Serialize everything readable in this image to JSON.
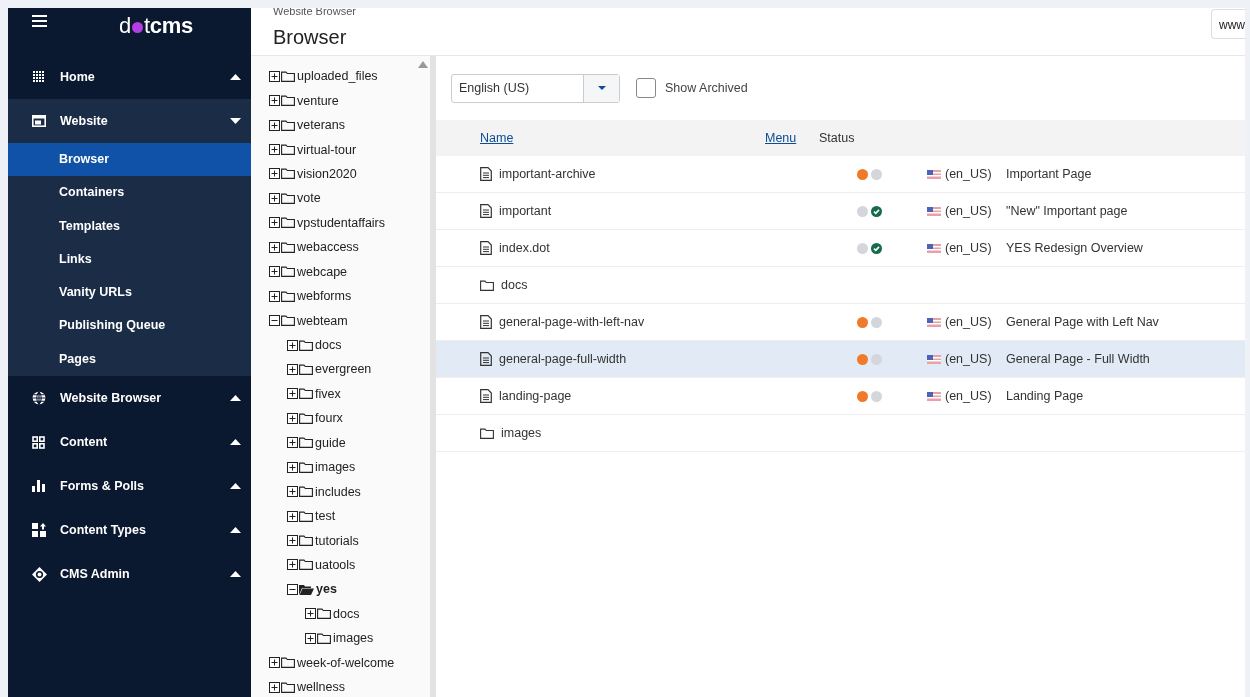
{
  "sidebar": {
    "logo": {
      "text_1": "d",
      "text_2": "t**cms**"
    },
    "groups": [
      {
        "label": "Home",
        "expanded": false
      },
      {
        "label": "Website",
        "expanded": true,
        "children": [
          {
            "label": "Browser",
            "selected": true
          },
          {
            "label": "Containers",
            "selected": false
          },
          {
            "label": "Templates",
            "selected": false
          },
          {
            "label": "Links",
            "selected": false
          },
          {
            "label": "Vanity URLs",
            "selected": false
          },
          {
            "label": "Publishing Queue",
            "selected": false
          },
          {
            "label": "Pages",
            "selected": false
          }
        ]
      },
      {
        "label": "Website Browser",
        "expanded": false
      },
      {
        "label": "Content",
        "expanded": false
      },
      {
        "label": "Forms & Polls",
        "expanded": false
      },
      {
        "label": "Content Types",
        "expanded": false
      },
      {
        "label": "CMS Admin",
        "expanded": false
      }
    ]
  },
  "header": {
    "breadcrumb": "Website Browser",
    "title": "Browser",
    "site_field": "www"
  },
  "tree": [
    {
      "label": "uploaded_files",
      "expanded": false,
      "selected": false
    },
    {
      "label": "venture",
      "expanded": false,
      "selected": false
    },
    {
      "label": "veterans",
      "expanded": false,
      "selected": false
    },
    {
      "label": "virtual-tour",
      "expanded": false,
      "selected": false
    },
    {
      "label": "vision2020",
      "expanded": false,
      "selected": false
    },
    {
      "label": "vote",
      "expanded": false,
      "selected": false
    },
    {
      "label": "vpstudentaffairs",
      "expanded": false,
      "selected": false
    },
    {
      "label": "webaccess",
      "expanded": false,
      "selected": false
    },
    {
      "label": "webcape",
      "expanded": false,
      "selected": false
    },
    {
      "label": "webforms",
      "expanded": false,
      "selected": false
    },
    {
      "label": "webteam",
      "expanded": true,
      "selected": false,
      "children": [
        {
          "label": "docs",
          "expanded": false,
          "selected": false
        },
        {
          "label": "evergreen",
          "expanded": false,
          "selected": false
        },
        {
          "label": "fivex",
          "expanded": false,
          "selected": false
        },
        {
          "label": "fourx",
          "expanded": false,
          "selected": false
        },
        {
          "label": "guide",
          "expanded": false,
          "selected": false
        },
        {
          "label": "images",
          "expanded": false,
          "selected": false
        },
        {
          "label": "includes",
          "expanded": false,
          "selected": false
        },
        {
          "label": "test",
          "expanded": false,
          "selected": false
        },
        {
          "label": "tutorials",
          "expanded": false,
          "selected": false
        },
        {
          "label": "uatools",
          "expanded": false,
          "selected": false
        },
        {
          "label": "yes",
          "expanded": true,
          "selected": true,
          "children": [
            {
              "label": "docs",
              "expanded": false,
              "selected": false
            },
            {
              "label": "images",
              "expanded": false,
              "selected": false
            }
          ]
        }
      ]
    },
    {
      "label": "week-of-welcome",
      "expanded": false,
      "selected": false
    },
    {
      "label": "wellness",
      "expanded": false,
      "selected": false
    }
  ],
  "filters": {
    "language": "English (US)",
    "show_archived": {
      "label": "Show Archived",
      "checked": false
    }
  },
  "table": {
    "columns": [
      {
        "label": "Name",
        "sortable": true
      },
      {
        "label": "Menu",
        "sortable": true
      },
      {
        "label": "Status",
        "sortable": false
      }
    ],
    "rows": [
      {
        "kind": "page",
        "name": "important-archive",
        "selected": false,
        "draft": true,
        "live": false,
        "language": "(en_US)",
        "title": "Important Page"
      },
      {
        "kind": "page",
        "name": "important",
        "selected": false,
        "draft": false,
        "live": true,
        "language": "(en_US)",
        "title": "\"New\" Important page"
      },
      {
        "kind": "page",
        "name": "index.dot",
        "selected": false,
        "draft": false,
        "live": true,
        "language": "(en_US)",
        "title": "YES Redesign Overview"
      },
      {
        "kind": "folder",
        "name": "docs",
        "selected": false
      },
      {
        "kind": "page",
        "name": "general-page-with-left-nav",
        "selected": false,
        "draft": true,
        "live": false,
        "language": "(en_US)",
        "title": "General Page with Left Nav"
      },
      {
        "kind": "page",
        "name": "general-page-full-width",
        "selected": true,
        "draft": true,
        "live": false,
        "language": "(en_US)",
        "title": "General Page - Full Width"
      },
      {
        "kind": "page",
        "name": "landing-page",
        "selected": false,
        "draft": true,
        "live": false,
        "language": "(en_US)",
        "title": "Landing Page"
      },
      {
        "kind": "folder",
        "name": "images",
        "selected": false
      }
    ]
  }
}
